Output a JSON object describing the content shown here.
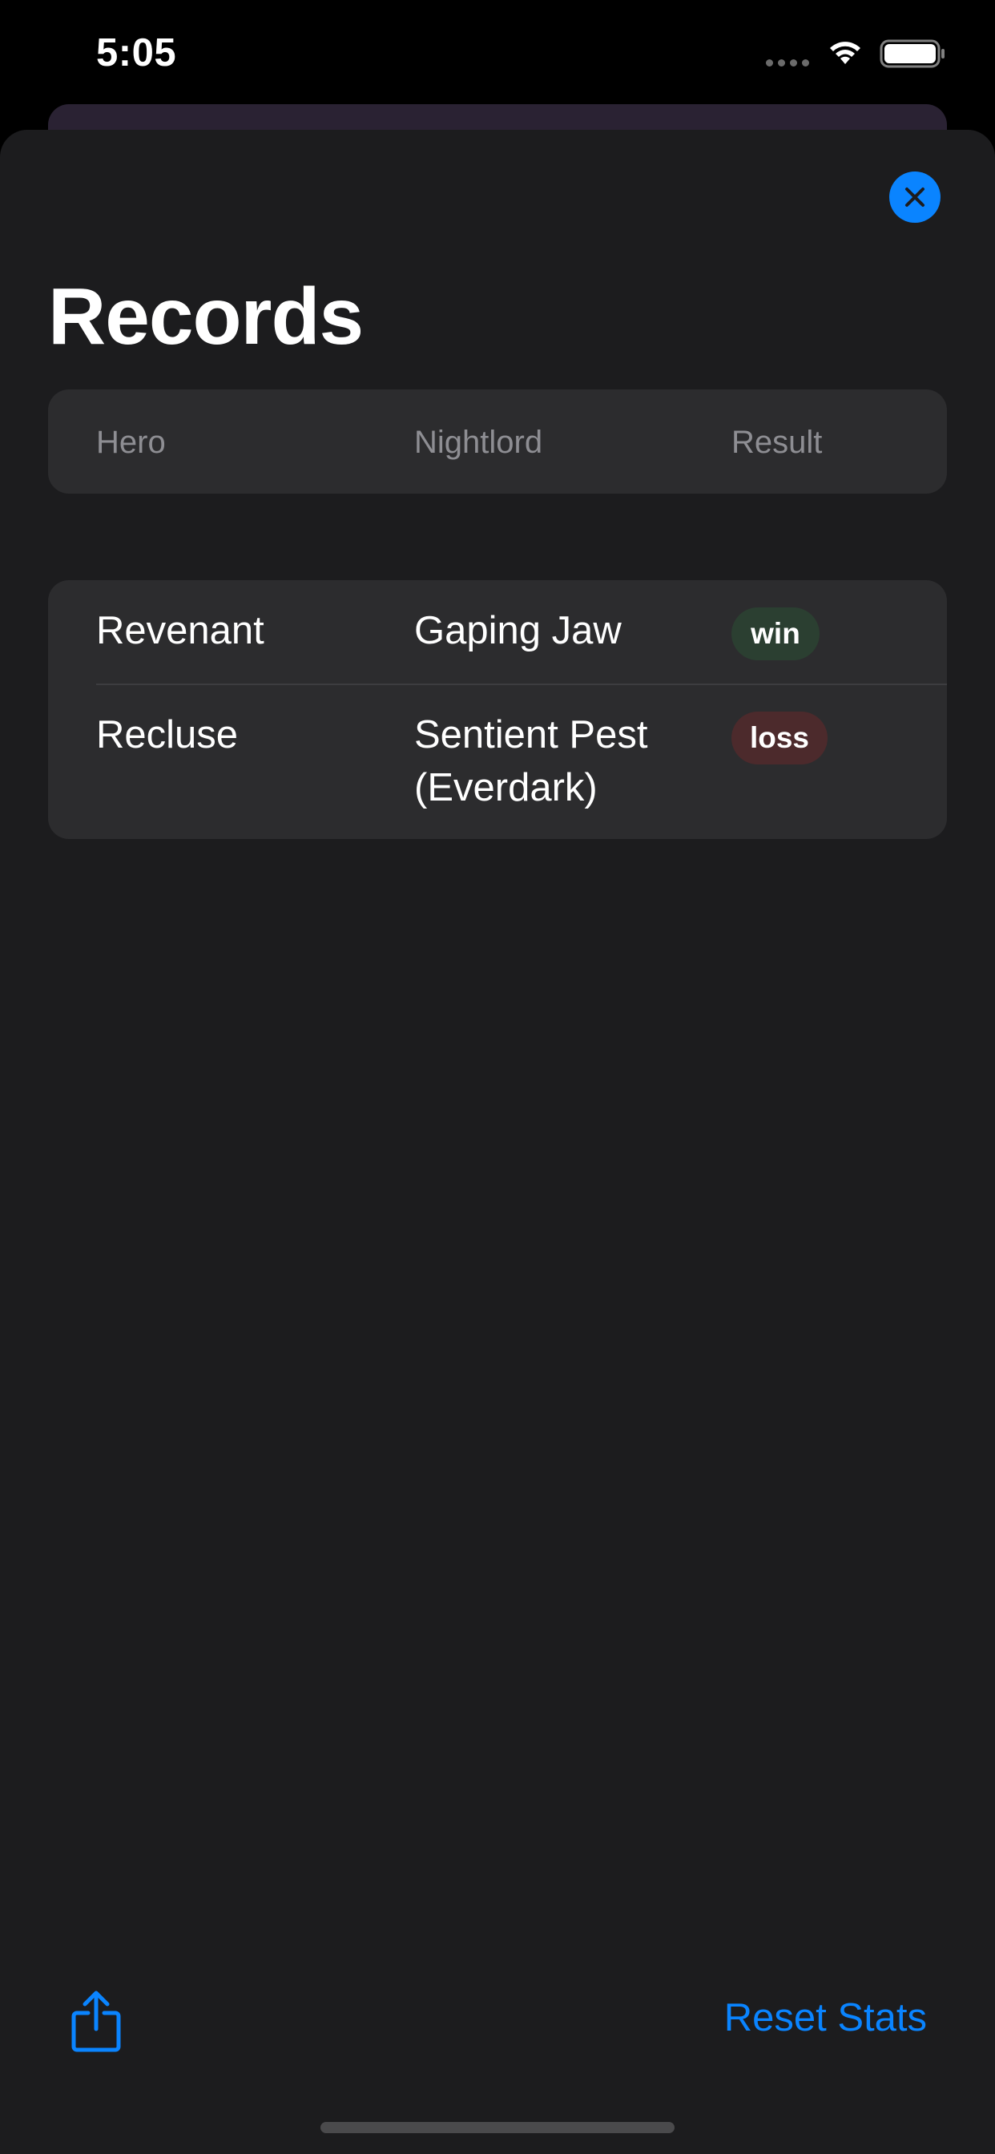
{
  "status_bar": {
    "time": "5:05"
  },
  "sheet": {
    "title": "Records",
    "close_icon": "close-icon",
    "accent_color": "#0a84ff"
  },
  "table": {
    "headers": [
      "Hero",
      "Nightlord",
      "Result"
    ],
    "rows": [
      {
        "hero": "Revenant",
        "nightlord": "Gaping Jaw",
        "result": "win"
      },
      {
        "hero": "Recluse",
        "nightlord": "Sentient Pest (Everdark)",
        "result": "loss"
      }
    ],
    "result_colors": {
      "win": "#2b3f31",
      "loss": "#4c2a2c"
    }
  },
  "toolbar": {
    "share_icon": "share-icon",
    "reset_label": "Reset Stats"
  }
}
